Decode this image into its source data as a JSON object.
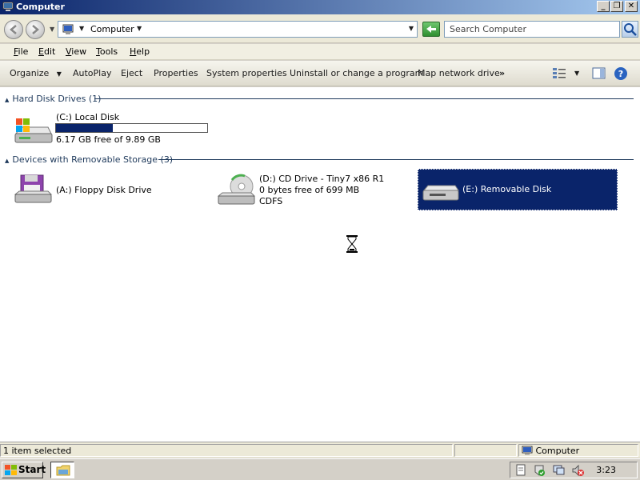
{
  "window": {
    "title": "Computer"
  },
  "address": {
    "location": "Computer",
    "search_placeholder": "Search Computer"
  },
  "menu": [
    "File",
    "Edit",
    "View",
    "Tools",
    "Help"
  ],
  "commands": {
    "organize": "Organize",
    "autoplay": "AutoPlay",
    "eject": "Eject",
    "properties": "Properties",
    "system_properties": "System properties",
    "uninstall": "Uninstall or change a program",
    "map_drive": "Map network drive",
    "more": "»"
  },
  "groups": {
    "hard_disks": {
      "header": "Hard Disk Drives (1)",
      "items": [
        {
          "name": "(C:) Local Disk",
          "free": "6.17 GB free of 9.89 GB",
          "used_fraction": 0.376
        }
      ]
    },
    "removable": {
      "header": "Devices with Removable Storage (3)",
      "items": [
        {
          "name": "(A:) Floppy Disk Drive"
        },
        {
          "name": "(D:) CD Drive - Tiny7 x86 R1",
          "free": "0 bytes free of 699 MB",
          "fs": "CDFS"
        },
        {
          "name": "(E:) Removable Disk",
          "selected": true
        }
      ]
    }
  },
  "status": {
    "selection": "1 item selected",
    "location": "Computer"
  },
  "taskbar": {
    "start": "Start",
    "clock": "3:23"
  },
  "colors": {
    "selection": "#0a246a",
    "group_header": "#1e395b"
  }
}
